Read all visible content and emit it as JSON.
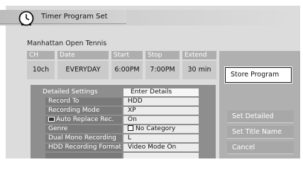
{
  "header": {
    "title": "Timer Program Set"
  },
  "program": {
    "name": "Manhattan Open Tennis"
  },
  "fields": [
    {
      "header": "CH",
      "value": "10ch"
    },
    {
      "header": "Date",
      "value": "EVERYDAY"
    },
    {
      "header": "Start",
      "value": "6:00PM"
    },
    {
      "header": "Stop",
      "value": "7:00PM"
    },
    {
      "header": "Extend",
      "value": "30 min"
    }
  ],
  "buttons": {
    "store_program": "Store Program",
    "set_detailed": "Set Detailed",
    "set_title_name": "Set Title Name",
    "cancel": "Cancel"
  },
  "details": {
    "heading_label": "Detailed Settings",
    "heading_value": "Enter Details",
    "rows": [
      {
        "label": "Record To",
        "value": "HDD"
      },
      {
        "label": "Recording Mode",
        "value": "XP"
      },
      {
        "label": "Auto Replace Rec.",
        "value": "On"
      },
      {
        "label": "Genre",
        "value": "No Category"
      },
      {
        "label": "Dual Mono Recording",
        "value": "L"
      },
      {
        "label": "HDD Recording Format",
        "value": "Video Mode On"
      }
    ]
  },
  "icons": {
    "title": "clock-icon",
    "auto_replace": "auto-replace-icon",
    "genre": "checkbox-icon"
  }
}
